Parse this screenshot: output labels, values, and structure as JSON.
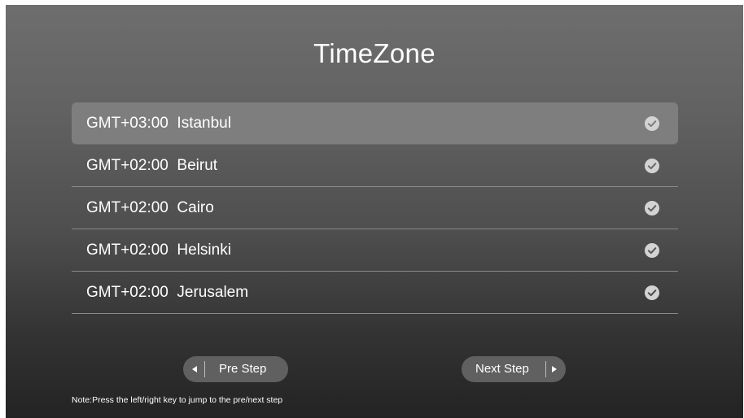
{
  "title": "TimeZone",
  "timezones": [
    {
      "label": "GMT+03:00  Istanbul",
      "selected": true
    },
    {
      "label": "GMT+02:00  Beirut",
      "selected": false
    },
    {
      "label": "GMT+02:00  Cairo",
      "selected": false
    },
    {
      "label": "GMT+02:00  Helsinki",
      "selected": false
    },
    {
      "label": "GMT+02:00  Jerusalem",
      "selected": false
    }
  ],
  "buttons": {
    "pre_label": "Pre Step",
    "next_label": "Next Step"
  },
  "note": "Note:Press the left/right key to jump to the pre/next step",
  "icons": {
    "row_status": "check-circle-icon",
    "pre_arrow": "triangle-left-icon",
    "next_arrow": "triangle-right-icon"
  },
  "colors": {
    "selected_row": "#7e7e7e",
    "button_bg": "#606060",
    "check_bg": "#d3d3d3",
    "text": "#ffffff"
  }
}
